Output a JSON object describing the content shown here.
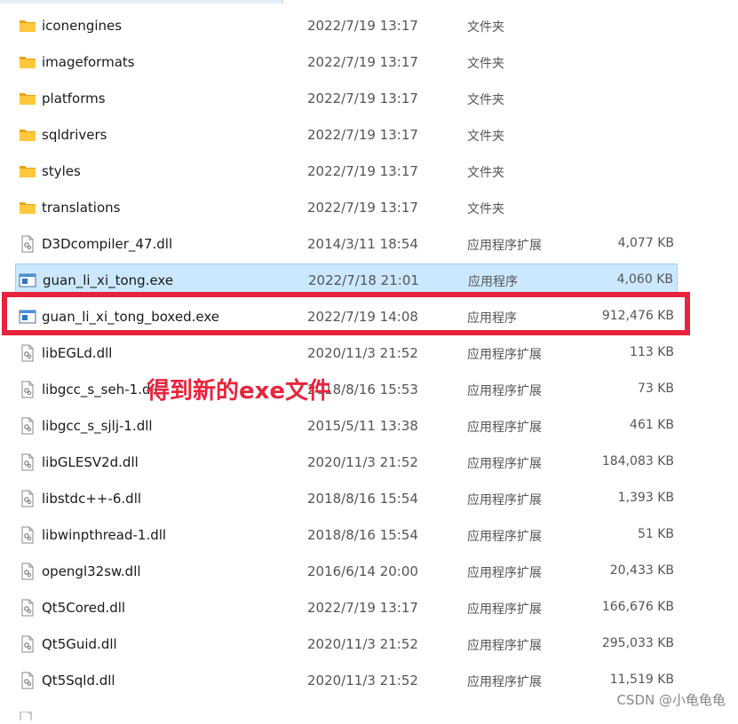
{
  "files": [
    {
      "name": "iconengines",
      "date": "2022/7/19 13:17",
      "type": "文件夹",
      "size": "",
      "icon": "folder-icon"
    },
    {
      "name": "imageformats",
      "date": "2022/7/19 13:17",
      "type": "文件夹",
      "size": "",
      "icon": "folder-icon"
    },
    {
      "name": "platforms",
      "date": "2022/7/19 13:17",
      "type": "文件夹",
      "size": "",
      "icon": "folder-icon"
    },
    {
      "name": "sqldrivers",
      "date": "2022/7/19 13:17",
      "type": "文件夹",
      "size": "",
      "icon": "folder-icon"
    },
    {
      "name": "styles",
      "date": "2022/7/19 13:17",
      "type": "文件夹",
      "size": "",
      "icon": "folder-icon"
    },
    {
      "name": "translations",
      "date": "2022/7/19 13:17",
      "type": "文件夹",
      "size": "",
      "icon": "folder-icon"
    },
    {
      "name": "D3Dcompiler_47.dll",
      "date": "2014/3/11 18:54",
      "type": "应用程序扩展",
      "size": "4,077 KB",
      "icon": "dll-file-icon"
    },
    {
      "name": "guan_li_xi_tong.exe",
      "date": "2022/7/18 21:01",
      "type": "应用程序",
      "size": "4,060 KB",
      "icon": "exe-file-icon",
      "selected": true
    },
    {
      "name": "guan_li_xi_tong_boxed.exe",
      "date": "2022/7/19 14:08",
      "type": "应用程序",
      "size": "912,476 KB",
      "icon": "exe-file-icon",
      "highlighted": true
    },
    {
      "name": "libEGLd.dll",
      "date": "2020/11/3 21:52",
      "type": "应用程序扩展",
      "size": "113 KB",
      "icon": "dll-file-icon"
    },
    {
      "name": "libgcc_s_seh-1.dll",
      "date": "2018/8/16 15:53",
      "type": "应用程序扩展",
      "size": "73 KB",
      "icon": "dll-file-icon"
    },
    {
      "name": "libgcc_s_sjlj-1.dll",
      "date": "2015/5/11 13:38",
      "type": "应用程序扩展",
      "size": "461 KB",
      "icon": "dll-file-icon"
    },
    {
      "name": "libGLESV2d.dll",
      "date": "2020/11/3 21:52",
      "type": "应用程序扩展",
      "size": "184,083 KB",
      "icon": "dll-file-icon"
    },
    {
      "name": "libstdc++-6.dll",
      "date": "2018/8/16 15:54",
      "type": "应用程序扩展",
      "size": "1,393 KB",
      "icon": "dll-file-icon"
    },
    {
      "name": "libwinpthread-1.dll",
      "date": "2018/8/16 15:54",
      "type": "应用程序扩展",
      "size": "51 KB",
      "icon": "dll-file-icon"
    },
    {
      "name": "opengl32sw.dll",
      "date": "2016/6/14 20:00",
      "type": "应用程序扩展",
      "size": "20,433 KB",
      "icon": "dll-file-icon"
    },
    {
      "name": "Qt5Cored.dll",
      "date": "2022/7/19 13:17",
      "type": "应用程序扩展",
      "size": "166,676 KB",
      "icon": "dll-file-icon"
    },
    {
      "name": "Qt5Guid.dll",
      "date": "2020/11/3 21:52",
      "type": "应用程序扩展",
      "size": "295,033 KB",
      "icon": "dll-file-icon"
    },
    {
      "name": "Qt5Sqld.dll",
      "date": "2020/11/3 21:52",
      "type": "应用程序扩展",
      "size": "11,519 KB",
      "icon": "dll-file-icon"
    }
  ],
  "annotation_text": "得到新的exe文件",
  "watermark": "CSDN @小龟龟龟",
  "colors": {
    "annotation_red": "#e8243c",
    "selected_bg": "#cce8ff",
    "selected_border": "#99d1ff",
    "folder_yellow": "#ffc83d"
  }
}
